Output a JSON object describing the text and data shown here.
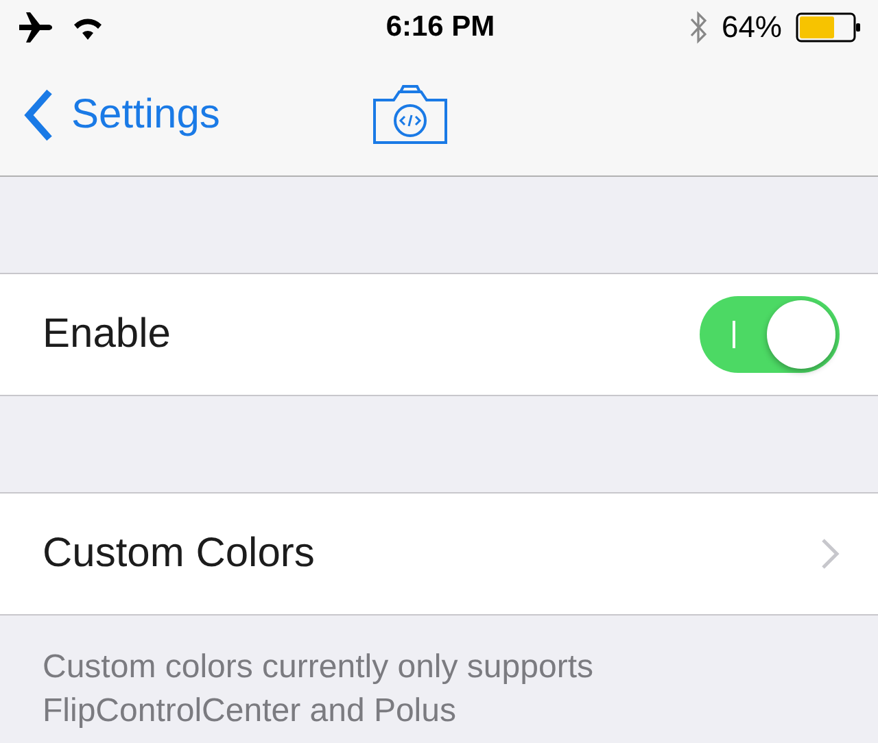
{
  "status_bar": {
    "time": "6:16 PM",
    "battery_percent": "64%"
  },
  "nav_bar": {
    "back_label": "Settings"
  },
  "rows": [
    {
      "kind": "switch",
      "label": "Enable",
      "on": true
    },
    {
      "kind": "link",
      "label": "Custom Colors"
    }
  ],
  "footer": "Custom colors currently only supports FlipControlCenter and Polus"
}
